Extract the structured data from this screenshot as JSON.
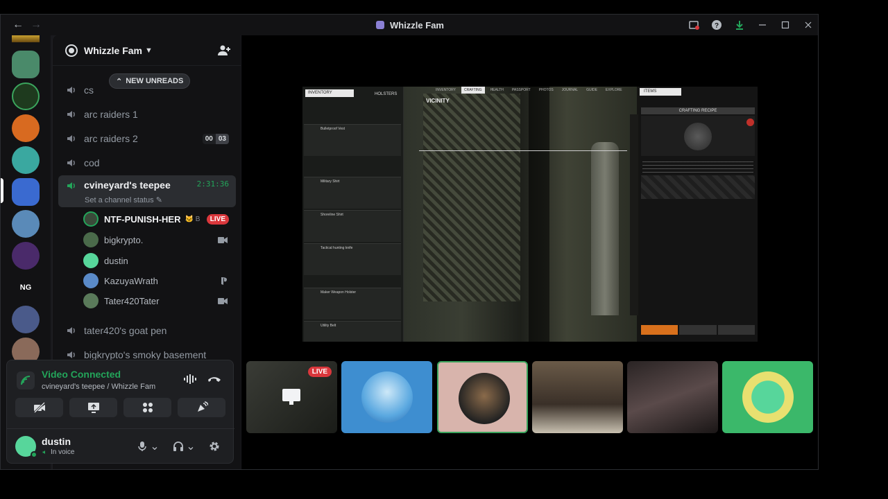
{
  "window": {
    "title": "Whizzle Fam",
    "controls": [
      "inbox-icon",
      "help-icon",
      "download-icon",
      "minimize-icon",
      "maximize-icon",
      "close-icon"
    ]
  },
  "server": {
    "name": "Whizzle Fam",
    "new_unreads_label": "NEW UNREADS"
  },
  "channels": [
    {
      "name": "cs"
    },
    {
      "name": "arc raiders 1"
    },
    {
      "name": "arc raiders 2",
      "badge_a": "00",
      "badge_b": "03"
    },
    {
      "name": "cod"
    },
    {
      "name": "cvineyard's teepee",
      "timer": "2:31:36",
      "status": "Set a channel status",
      "active": true
    },
    {
      "name": "tater420's goat pen"
    },
    {
      "name": "bigkrypto's smoky basement"
    }
  ],
  "voice_users": [
    {
      "name": "NTF-PUNISH-HER",
      "extra": "🐱 B",
      "live_label": "LIVE",
      "avatar_color": "#3a4a3a"
    },
    {
      "name": "bigkrypto.",
      "icon": "camera-icon",
      "avatar_color": "#4a6a4a"
    },
    {
      "name": "dustin",
      "avatar_color": "#57d69b"
    },
    {
      "name": "KazuyaWrath",
      "icon": "playstation-icon",
      "avatar_color": "#5a8ac8"
    },
    {
      "name": "Tater420Tater",
      "icon": "camera-icon",
      "avatar_color": "#5a7a5a"
    }
  ],
  "voice_panel": {
    "title": "Video Connected",
    "subtitle": "cvineyard's teepee / Whizzle Fam",
    "user_name": "dustin",
    "user_status": "In voice"
  },
  "game": {
    "tabs_left": [
      "INVENTORY",
      "HOLSTERS"
    ],
    "tabs_top": [
      "INVENTORY",
      "CRAFTING",
      "HEALTH",
      "PASSPORT",
      "PHOTOS",
      "JOURNAL",
      "GUIDE",
      "EXPLORE"
    ],
    "vicinity_label": "VICINITY",
    "items_tab": "ITEMS",
    "recipe_header": "CRAFTING RECIPE",
    "rows": [
      "Bulletproof Vest",
      "Military Shirt",
      "Shoreline Shirt",
      "Tactical hunting knife",
      "Maker Weapon Holster",
      "Utility Belt"
    ]
  },
  "tiles": [
    {
      "live_label": "LIVE",
      "bg": "#2a2c28"
    },
    {
      "bg": "#3e8ed0",
      "avatar_color": "#8fc8f0"
    },
    {
      "bg": "#d8b4ac",
      "avatar_color": "#222",
      "speaking": true
    },
    {
      "bg": "#5a5048"
    },
    {
      "bg": "#3a3434"
    },
    {
      "bg": "#3bb86a",
      "avatar_color": "#e8e070"
    }
  ],
  "colors": {
    "accent_green": "#23a55a",
    "live_red": "#da373c"
  }
}
